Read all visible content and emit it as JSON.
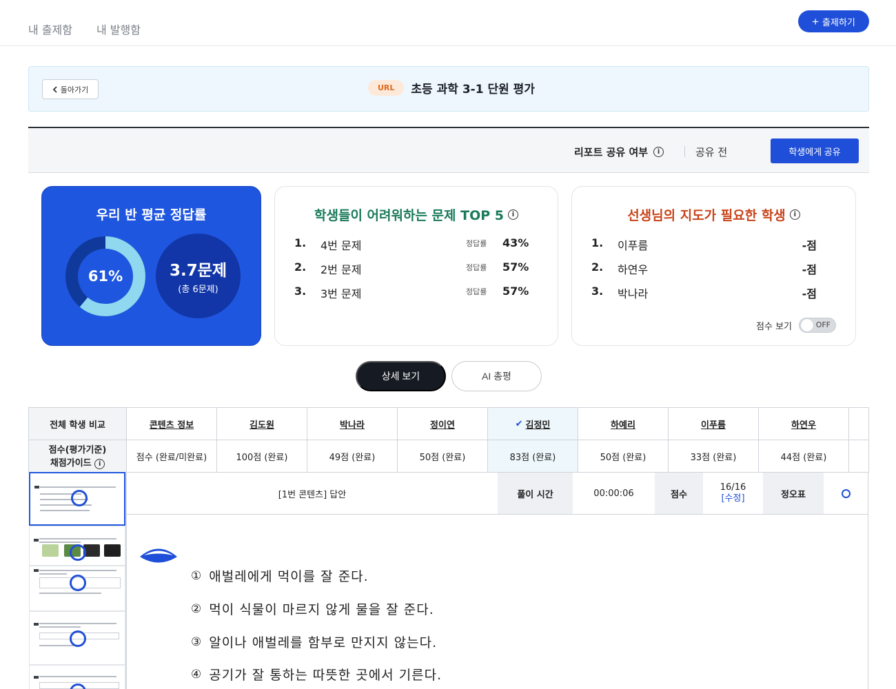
{
  "nav": {
    "tabs": [
      "내 출제함",
      "내 발행함"
    ],
    "create_label": "출제하기"
  },
  "banner": {
    "back_label": "돌아가기",
    "badge": "URL",
    "title": "초등 과학 3-1 단원 평가"
  },
  "share": {
    "label": "리포트 공유 여부",
    "status": "공유 전",
    "button": "학생에게 공유"
  },
  "avg_card": {
    "title": "우리 반 평균 정답률",
    "percent_text": "61%",
    "percent": 61,
    "avg_value": "3.7문제",
    "avg_total": "(총 6문제)"
  },
  "top5_card": {
    "title": "학생들이 어려워하는 문제 TOP 5",
    "rate_label": "정답률",
    "items": [
      {
        "rank": "1.",
        "question": "4번 문제",
        "rate": "43%"
      },
      {
        "rank": "2.",
        "question": "2번 문제",
        "rate": "57%"
      },
      {
        "rank": "3.",
        "question": "3번 문제",
        "rate": "57%"
      }
    ]
  },
  "guide_card": {
    "title": "선생님의 지도가 필요한 학생",
    "items": [
      {
        "rank": "1.",
        "name": "이푸름",
        "score": "-점"
      },
      {
        "rank": "2.",
        "name": "하연우",
        "score": "-점"
      },
      {
        "rank": "3.",
        "name": "박나라",
        "score": "-점"
      }
    ],
    "score_toggle_label": "점수 보기",
    "toggle_state": "OFF"
  },
  "view_tabs": {
    "detail": "상세 보기",
    "ai": "AI 총평"
  },
  "table": {
    "corner_header": "전체 학생 비교",
    "corner_row_line1": "점수(평가기준)",
    "corner_row_line2": "채점가이드",
    "columns": [
      {
        "name": "콘텐츠 정보",
        "score": "점수 (완료/미완료)",
        "selected": false
      },
      {
        "name": "김도원",
        "score": "100점 (완료)",
        "selected": false
      },
      {
        "name": "박나라",
        "score": "49점 (완료)",
        "selected": false
      },
      {
        "name": "정이연",
        "score": "50점 (완료)",
        "selected": false
      },
      {
        "name": "김정민",
        "score": "83점 (완료)",
        "selected": true
      },
      {
        "name": "하예리",
        "score": "50점 (완료)",
        "selected": false
      },
      {
        "name": "이푸름",
        "score": "33점 (완료)",
        "selected": false
      },
      {
        "name": "하연우",
        "score": "44점 (완료)",
        "selected": false
      }
    ]
  },
  "answer": {
    "content_label": "[1번 콘텐츠] 답안",
    "time_label": "풀이 시간",
    "time_value": "00:00:06",
    "score_label": "점수",
    "score_value": "16/16",
    "edit_label": "[수정]",
    "result_label": "정오표",
    "options": [
      {
        "no": "①",
        "text": "애벌레에게 먹이를 잘 준다."
      },
      {
        "no": "②",
        "text": "먹이 식물이 마르지 않게 물을 잘 준다."
      },
      {
        "no": "③",
        "text": "알이나 애벌레를 함부로 만지지 않는다."
      },
      {
        "no": "④",
        "text": "공기가 잘 통하는 따뜻한 곳에서 기른다."
      }
    ]
  },
  "colors": {
    "primary": "#1f4fd8",
    "card_blue": "#1f56df",
    "ring_fill": "#8fd8f0",
    "ring_track": "#0f3a9c"
  }
}
